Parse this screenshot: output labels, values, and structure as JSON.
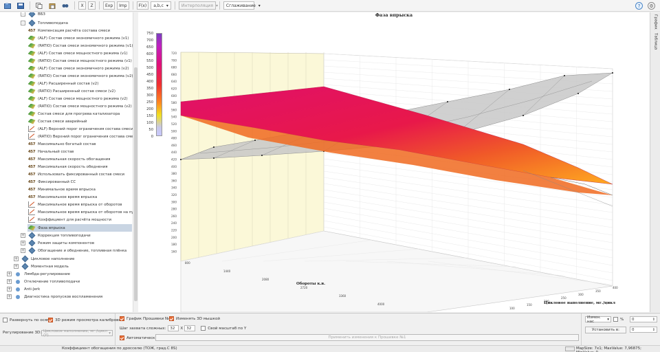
{
  "toolbar": {
    "btn_x": "X",
    "btn_z": "Z",
    "btn_exp": "Exp",
    "btn_imp": "Imp",
    "btn_fx": "F(x)",
    "btn_abc": "a,b,c",
    "interp_label": "Интерполяция",
    "smooth_label": "Сглаживание",
    "help_glyph": "?"
  },
  "tree": {
    "items": [
      {
        "label": "ВБЗ"
      },
      {
        "label": "Топливоподача"
      },
      {
        "label": "Компенсация расчёта состава смеси"
      },
      {
        "label": "(ALF) Состав смеси экономичного режима (v1)"
      },
      {
        "label": "(RATIO) Состав смеси экономичного режима (v1)"
      },
      {
        "label": "(ALF) Состав смеси мощностного режима (v1)"
      },
      {
        "label": "(RATIO) Состав смеси мощностного режима (v1)"
      },
      {
        "label": "(ALF) Состав смеси экономичного режима (v2)"
      },
      {
        "label": "(RATIO) Состав смеси экономичного режима (v2)"
      },
      {
        "label": "(ALF) Расширенный состав (v2)"
      },
      {
        "label": "(RATIO) Расширенный состав смеси (v2)"
      },
      {
        "label": "(ALF) Состав смеси мощностного режима (v2)"
      },
      {
        "label": "(RATIO) Состав смеси мощностного режима (v2)"
      },
      {
        "label": "Состав смеси для прогрева катализатора"
      },
      {
        "label": "Состав смеси аварийный"
      },
      {
        "label": "(ALF) Верхний порог ограничения состава смеси"
      },
      {
        "label": "(RATIO) Верхний порог ограничения состава смеси"
      },
      {
        "label": "Максимально богатый состав"
      },
      {
        "label": "Начальный состав"
      },
      {
        "label": "Максимальная скорость обогащения"
      },
      {
        "label": "Максимальная скорость обеднения"
      },
      {
        "label": "Использовать фиксированный состав смеси"
      },
      {
        "label": "Фиксированный СС"
      },
      {
        "label": "Минимальное время впрыска"
      },
      {
        "label": "Максимальное время впрыска"
      },
      {
        "label": "Максимальное время впрыска от оборотов"
      },
      {
        "label": "Максимальное время впрыска от оборотов на пуске"
      },
      {
        "label": "Коэффициент для расчёта мощности"
      },
      {
        "label": "Фаза впрыска"
      },
      {
        "label": "Коррекция топливоподачи"
      },
      {
        "label": "Режим защиты компонентов"
      },
      {
        "label": "Обогащение и обеднение, топливная плёнка"
      },
      {
        "label": "Цикловое наполнение"
      },
      {
        "label": "Моментная модель"
      },
      {
        "label": "Лямбда-регулирование"
      },
      {
        "label": "Отключение топливоподачи"
      },
      {
        "label": "Anti-Jerk"
      },
      {
        "label": "Диагностика пропусков воспламенения"
      }
    ]
  },
  "chart": {
    "title": "Фаза впрыска",
    "x_axis_label": "Обороты к.в.",
    "y_axis_label": "Цикловое наполнение, мг./цикл",
    "legend_ticks": [
      "750",
      "700",
      "650",
      "600",
      "550",
      "500",
      "450",
      "400",
      "350",
      "300",
      "250",
      "200",
      "150",
      "100",
      "50",
      "0"
    ],
    "wall_ticks": [
      "720",
      "700",
      "680",
      "660",
      "640",
      "620",
      "600",
      "580",
      "560",
      "540",
      "520",
      "500",
      "480",
      "460",
      "440",
      "420",
      "400",
      "380",
      "360",
      "340",
      "320",
      "300",
      "280",
      "260",
      "240",
      "220",
      "200",
      "180",
      "160"
    ],
    "rpm_ticks": [
      "800",
      "1440",
      "2080",
      "2720",
      "3360",
      "4000"
    ],
    "load_ticks": [
      "100",
      "150",
      "200",
      "250",
      "300",
      "350",
      "400"
    ],
    "side_tabs": [
      "График",
      "Таблица"
    ]
  },
  "chart_data": {
    "type": "surface-3d",
    "title": "Фаза впрыска",
    "xlabel": "Обороты к.в.",
    "ylabel": "Цикловое наполнение, мг./цикл",
    "zlim": [
      0,
      750
    ],
    "legend_ticks": [
      750,
      700,
      650,
      600,
      550,
      500,
      450,
      400,
      350,
      300,
      250,
      200,
      150,
      100,
      50,
      0
    ],
    "series": [
      {
        "name": "",
        "surface": "colored",
        "z_range": [
          300,
          620
        ]
      },
      {
        "name": "",
        "surface": "gray",
        "z_range": [
          340,
          720
        ]
      }
    ]
  },
  "bottom": {
    "expand_axes": "Развернуть по осям",
    "view_3d": "3D режим просмотра калибровки",
    "regulation_label": "Регулирование 3D:",
    "regulation_value": "Цикловое наполнение, мг./цикл (Y)",
    "graph_firmware": "График Прошивки №2",
    "change_3d_mouse": "Изменять 3D мышкой",
    "grid_step_label": "Шаг захвата сложных:",
    "grid_step_x": "32",
    "grid_step_x_sep": "X",
    "grid_step_y": "32",
    "own_scale": "Свой масштаб по Y",
    "auto_label": "Автоматически",
    "apply_button": "Применить изменения к Прошивке №1",
    "change_mode": "Измен. нас",
    "percent_label": "%",
    "change_value": "0",
    "set_to_label": "Установить в:",
    "set_to_value": "0"
  },
  "status": {
    "left_text": "Коэффициент обогащения по дросселю (ТОЖ, град.C 8S)",
    "right_text": "MapSize: 7x1; MaxValue: 7,96875; MinValue: 0"
  }
}
